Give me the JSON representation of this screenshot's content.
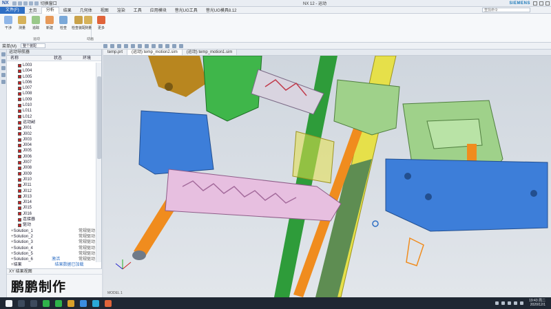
{
  "titlebar": {
    "logo": "NX",
    "quick_access_text": "切换窗口",
    "window_title": "NX 12 - 运动",
    "brand": "SIEMENS"
  },
  "menu": {
    "file": "文件(F)",
    "tabs": [
      "主页",
      "分析",
      "结果",
      "几何体",
      "视图",
      "渲染",
      "工具",
      "应用模块",
      "菩光UG工具",
      "菩光UG模具8.12"
    ],
    "active_tab": 1,
    "search_placeholder": "查找命令"
  },
  "ribbon": {
    "buttons": [
      "干涉",
      "测量",
      "追踪",
      "新建",
      "检查",
      "检查装配",
      "测量",
      "更多"
    ],
    "groups": [
      "运动",
      "动画"
    ]
  },
  "commandbar": {
    "menu": "菜单(M)",
    "filter": "整个装配"
  },
  "navigator": {
    "title": "运动导航器",
    "col_name": "名称",
    "col_status": "状态",
    "col_environment": "环境",
    "rows": [
      {
        "label": "L003",
        "check": true
      },
      {
        "label": "L004",
        "check": true
      },
      {
        "label": "L005",
        "check": true
      },
      {
        "label": "L006",
        "check": true
      },
      {
        "label": "L007",
        "check": true
      },
      {
        "label": "L008",
        "check": true
      },
      {
        "label": "L009",
        "check": true
      },
      {
        "label": "L010",
        "check": true
      },
      {
        "label": "L011",
        "check": true
      },
      {
        "label": "L012",
        "check": true
      },
      {
        "label": "运动副",
        "check": true
      },
      {
        "label": "J001",
        "check": true
      },
      {
        "label": "J002",
        "check": true
      },
      {
        "label": "J003",
        "check": true
      },
      {
        "label": "J004",
        "check": true
      },
      {
        "label": "J005",
        "check": true
      },
      {
        "label": "J006",
        "check": true
      },
      {
        "label": "J007",
        "check": true
      },
      {
        "label": "J008",
        "check": true
      },
      {
        "label": "J009",
        "check": true
      },
      {
        "label": "J010",
        "check": true
      },
      {
        "label": "J011",
        "check": true
      },
      {
        "label": "J012",
        "check": true
      },
      {
        "label": "J013",
        "check": true
      },
      {
        "label": "J014",
        "check": true
      },
      {
        "label": "J015",
        "check": true
      },
      {
        "label": "J016",
        "check": true
      },
      {
        "label": "连接器",
        "check": true
      },
      {
        "label": "驱动",
        "check": true
      },
      {
        "label": "Solution_1",
        "status": "",
        "env": "常规驱动"
      },
      {
        "label": "Solution_2",
        "status": "",
        "env": "常规驱动"
      },
      {
        "label": "Solution_3",
        "status": "",
        "env": "常规驱动"
      },
      {
        "label": "Solution_4",
        "status": "",
        "env": "常规驱动"
      },
      {
        "label": "Solution_5",
        "status": "",
        "env": "常规驱动"
      },
      {
        "label": "Solution_6",
        "status": "激活",
        "env": "常规驱动"
      },
      {
        "label": "结果",
        "status": "结果数据已加载",
        "env": ""
      }
    ]
  },
  "preview": {
    "title": "XY 结果视图",
    "watermark": "鹏鹏制作"
  },
  "doc_tabs": [
    "temp.prt",
    "(运动) temp_motion2.sim",
    "(运动) temp_motion1.sim"
  ],
  "active_doc_tab": 1,
  "viewport_label": "MODEL 1",
  "clock": {
    "time": "19:43 周二",
    "date": "2020/12/1"
  },
  "colors": {
    "accent": "#2f6fc4",
    "blue_part": "#3d7ed9",
    "green_part": "#9fd18a",
    "pink_part": "#e7bfe0",
    "orange_pin": "#f08c1e",
    "yellow_part": "#e6e04a"
  }
}
